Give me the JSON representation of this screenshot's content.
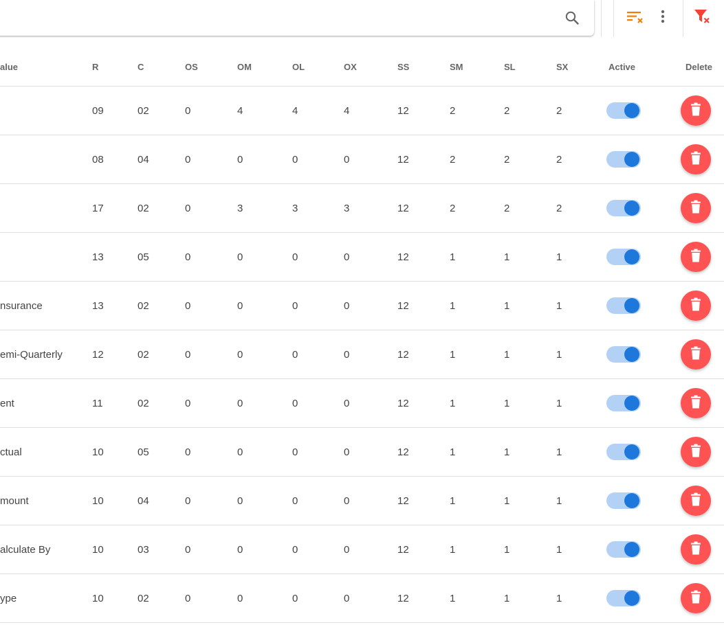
{
  "toolbar": {
    "search_value": "",
    "search_placeholder": "",
    "icons": [
      "search-icon",
      "clear-sort-icon",
      "more-vert-icon",
      "clear-filter-icon"
    ],
    "accent_orange": "#f57c00",
    "accent_red": "#f44336"
  },
  "table": {
    "headers": {
      "value": "alue",
      "r": "R",
      "c": "C",
      "os": "OS",
      "om": "OM",
      "ol": "OL",
      "ox": "OX",
      "ss": "SS",
      "sm": "SM",
      "sl": "SL",
      "sx": "SX",
      "active": "Active",
      "delete": "Delete"
    },
    "rows": [
      {
        "value": "",
        "r": "09",
        "c": "02",
        "os": "0",
        "om": "4",
        "ol": "4",
        "ox": "4",
        "ss": "12",
        "sm": "2",
        "sl": "2",
        "sx": "2",
        "active": true
      },
      {
        "value": "",
        "r": "08",
        "c": "04",
        "os": "0",
        "om": "0",
        "ol": "0",
        "ox": "0",
        "ss": "12",
        "sm": "2",
        "sl": "2",
        "sx": "2",
        "active": true
      },
      {
        "value": "",
        "r": "17",
        "c": "02",
        "os": "0",
        "om": "3",
        "ol": "3",
        "ox": "3",
        "ss": "12",
        "sm": "2",
        "sl": "2",
        "sx": "2",
        "active": true
      },
      {
        "value": "",
        "r": "13",
        "c": "05",
        "os": "0",
        "om": "0",
        "ol": "0",
        "ox": "0",
        "ss": "12",
        "sm": "1",
        "sl": "1",
        "sx": "1",
        "active": true
      },
      {
        "value": "nsurance",
        "r": "13",
        "c": "02",
        "os": "0",
        "om": "0",
        "ol": "0",
        "ox": "0",
        "ss": "12",
        "sm": "1",
        "sl": "1",
        "sx": "1",
        "active": true
      },
      {
        "value": "emi-Quarterly",
        "r": "12",
        "c": "02",
        "os": "0",
        "om": "0",
        "ol": "0",
        "ox": "0",
        "ss": "12",
        "sm": "1",
        "sl": "1",
        "sx": "1",
        "active": true
      },
      {
        "value": "ent",
        "r": "11",
        "c": "02",
        "os": "0",
        "om": "0",
        "ol": "0",
        "ox": "0",
        "ss": "12",
        "sm": "1",
        "sl": "1",
        "sx": "1",
        "active": true
      },
      {
        "value": "ctual",
        "r": "10",
        "c": "05",
        "os": "0",
        "om": "0",
        "ol": "0",
        "ox": "0",
        "ss": "12",
        "sm": "1",
        "sl": "1",
        "sx": "1",
        "active": true
      },
      {
        "value": "mount",
        "r": "10",
        "c": "04",
        "os": "0",
        "om": "0",
        "ol": "0",
        "ox": "0",
        "ss": "12",
        "sm": "1",
        "sl": "1",
        "sx": "1",
        "active": true
      },
      {
        "value": "alculate By",
        "r": "10",
        "c": "03",
        "os": "0",
        "om": "0",
        "ol": "0",
        "ox": "0",
        "ss": "12",
        "sm": "1",
        "sl": "1",
        "sx": "1",
        "active": true
      },
      {
        "value": "ype",
        "r": "10",
        "c": "02",
        "os": "0",
        "om": "0",
        "ol": "0",
        "ox": "0",
        "ss": "12",
        "sm": "1",
        "sl": "1",
        "sx": "1",
        "active": true
      }
    ],
    "toggle_track_color": "#b3d1f5",
    "toggle_knob_color": "#1e78dc",
    "delete_color": "#ff5252",
    "row_icons": [
      "toggle-switch",
      "trash-icon"
    ]
  }
}
